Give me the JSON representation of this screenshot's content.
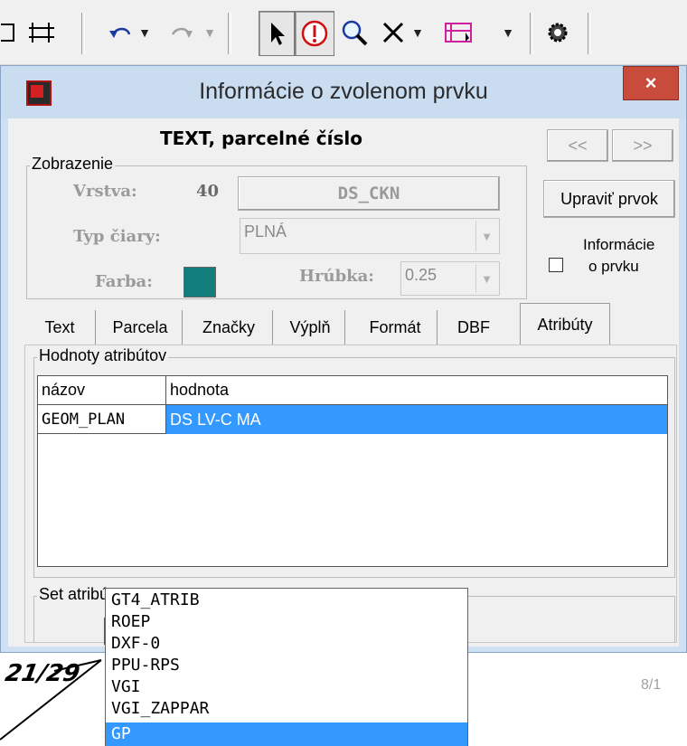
{
  "toolbar": {
    "icons": [
      "frame-tool-icon",
      "grid-tool-icon",
      "undo-icon",
      "redo-icon",
      "arrow-select-icon",
      "info-icon",
      "zoom-icon",
      "delete-icon",
      "select-region-icon",
      "settings-gear-icon"
    ]
  },
  "window": {
    "title": "Informácie o zvolenom prvku",
    "close": "×",
    "element_type": "TEXT, parcelné číslo",
    "nav_prev": "<<",
    "nav_next": ">>",
    "edit_button": "Upraviť prvok",
    "info_checkbox_label_1": "Informácie",
    "info_checkbox_label_2": "o prvku",
    "info_checked": false
  },
  "display": {
    "group_title": "Zobrazenie",
    "layer_label": "Vrstva:",
    "layer_value": "40",
    "layer_button": "DS_CKN",
    "line_type_label": "Typ čiary:",
    "line_type_value": "PLNÁ",
    "color_label": "Farba:",
    "color_value": "#117d7d",
    "thickness_label": "Hrúbka:",
    "thickness_value": "0.25"
  },
  "tabs": [
    "Text",
    "Parcela",
    "Značky",
    "Výplň",
    "Formát",
    "DBF",
    "Atribúty"
  ],
  "active_tab": "Atribúty",
  "attributes": {
    "group_title": "Hodnoty atribútov",
    "columns": [
      "názov",
      "hodnota"
    ],
    "rows": [
      {
        "name": "GEOM_PLAN",
        "value": "DS LV-C MA"
      }
    ]
  },
  "attribute_set": {
    "group_title": "Set atribútov",
    "selected": "GP",
    "options": [
      "GT4_ATRIB",
      "ROEP",
      "DXF-0",
      "PPU-RPS",
      "VGI",
      "VGI_ZAPPAR",
      "GP"
    ],
    "counter": "8/1"
  },
  "background_text": "21/29"
}
